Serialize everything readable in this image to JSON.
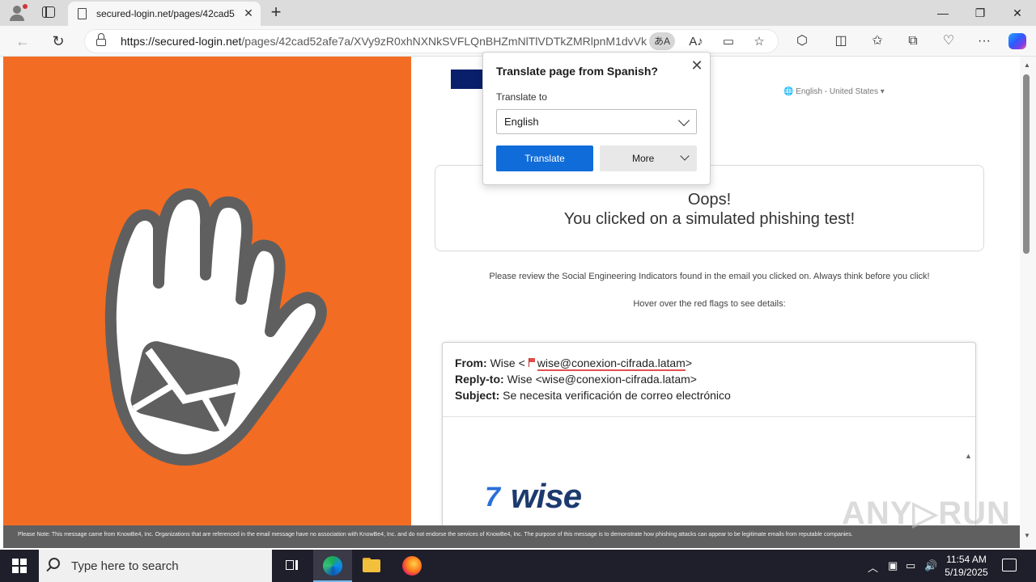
{
  "browser": {
    "tab_title": "secured-login.net/pages/42cad5",
    "url_host": "https://secured-login.net",
    "url_path": "/pages/42cad52afe7a/XVy9zR0xhNXNkSVFLQnBHZmNlTlVDTkZMRlpnM1dvVk...",
    "translate_chip": "あA",
    "window_minimize": "—",
    "window_restore": "❐",
    "window_close": "✕"
  },
  "translate_popup": {
    "title": "Translate page from Spanish?",
    "label": "Translate to",
    "selected_language": "English",
    "translate_button": "Translate",
    "more_button": "More"
  },
  "page": {
    "language_picker": "English - United States",
    "oops_title": "Oops!",
    "oops_subtitle": "You clicked on a simulated phishing test!",
    "review_text": "Please review the Social Engineering Indicators found in the email you clicked on. Always think before you click!",
    "hover_text": "Hover over the red flags to see details:",
    "email": {
      "from_label": "From:",
      "from_name": "Wise <",
      "from_address": "wise@conexion-cifrada.latam",
      "from_close": ">",
      "reply_label": "Reply-to:",
      "reply_value": "Wise <wise@conexion-cifrada.latam>",
      "subject_label": "Subject:",
      "subject_value": "Se necesita verificación de correo electrónico",
      "logo_text": "wise",
      "logo_mark": "7"
    },
    "note": "Please Note: This message came from KnowBe4, Inc. Organizations that are referenced in the email message have no association with KnowBe4, Inc. and do not endorse the services of KnowBe4, Inc. The purpose of this message is to demonstrate how phishing attacks can appear to be legitimate emails from reputable companies.",
    "watermark": "ANY▷RUN"
  },
  "taskbar": {
    "search_placeholder": "Type here to search",
    "time": "11:54 AM",
    "date": "5/19/2025"
  },
  "colors": {
    "hand_panel": "#f26c23",
    "translate_button": "#0f6cd8",
    "flag": "#e34a4a"
  }
}
